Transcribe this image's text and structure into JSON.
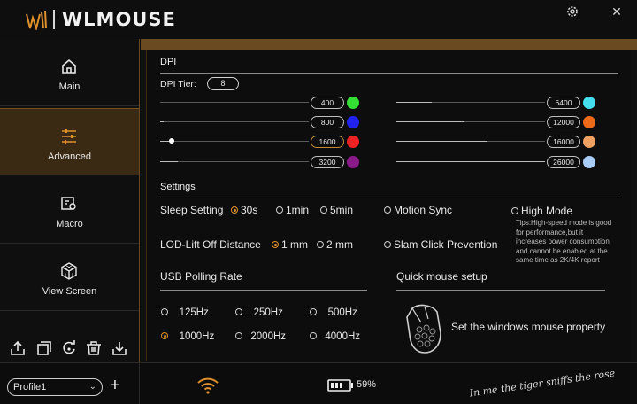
{
  "app": {
    "brand": "WLMOUSE"
  },
  "window": {
    "settings_icon": "gear-icon",
    "close_icon": "close-icon"
  },
  "sidebar": {
    "items": [
      {
        "label": "Main",
        "icon": "home-icon",
        "active": false
      },
      {
        "label": "Advanced",
        "icon": "sliders-icon",
        "active": true
      },
      {
        "label": "Macro",
        "icon": "macro-icon",
        "active": false
      },
      {
        "label": "View Screen",
        "icon": "cube-icon",
        "active": false
      }
    ],
    "tools": [
      "export-icon",
      "copy-icon",
      "reset-icon",
      "delete-icon",
      "import-icon"
    ]
  },
  "dpi": {
    "title": "DPI",
    "tier_label": "DPI Tier:",
    "tier_value": "8",
    "left": [
      {
        "value": "400",
        "color": "#33dd33",
        "selected": false
      },
      {
        "value": "800",
        "color": "#2222ee",
        "selected": false
      },
      {
        "value": "1600",
        "color": "#ee2222",
        "selected": true
      },
      {
        "value": "3200",
        "color": "#8a1a8a",
        "selected": false
      }
    ],
    "right": [
      {
        "value": "6400",
        "color": "#44ddee"
      },
      {
        "value": "12000",
        "color": "#ee6a1a"
      },
      {
        "value": "16000",
        "color": "#f0a060"
      },
      {
        "value": "26000",
        "color": "#a8ccf5"
      }
    ]
  },
  "settings": {
    "title": "Settings",
    "sleep_label": "Sleep Setting",
    "sleep_options": [
      "30s",
      "1min",
      "5min"
    ],
    "motion_sync": "Motion Sync",
    "high_mode": "High Mode",
    "tips": "Tips:High-speed mode is good for performance,but it increases power consumption and cannot be enabled at the same time as 2K/4K report",
    "lod_label": "LOD-Lift Off Distance",
    "lod_options": [
      "1 mm",
      "2 mm"
    ],
    "slam_click": "Slam Click Prevention"
  },
  "usb": {
    "title": "USB Polling Rate",
    "options": [
      "125Hz",
      "250Hz",
      "500Hz",
      "1000Hz",
      "2000Hz",
      "4000Hz"
    ],
    "selected": "1000Hz"
  },
  "quick": {
    "title": "Quick mouse setup",
    "text": "Set the windows mouse property"
  },
  "footer": {
    "profile": "Profile1",
    "battery": "59%",
    "signature": "In me the tiger sniffs the rose"
  }
}
